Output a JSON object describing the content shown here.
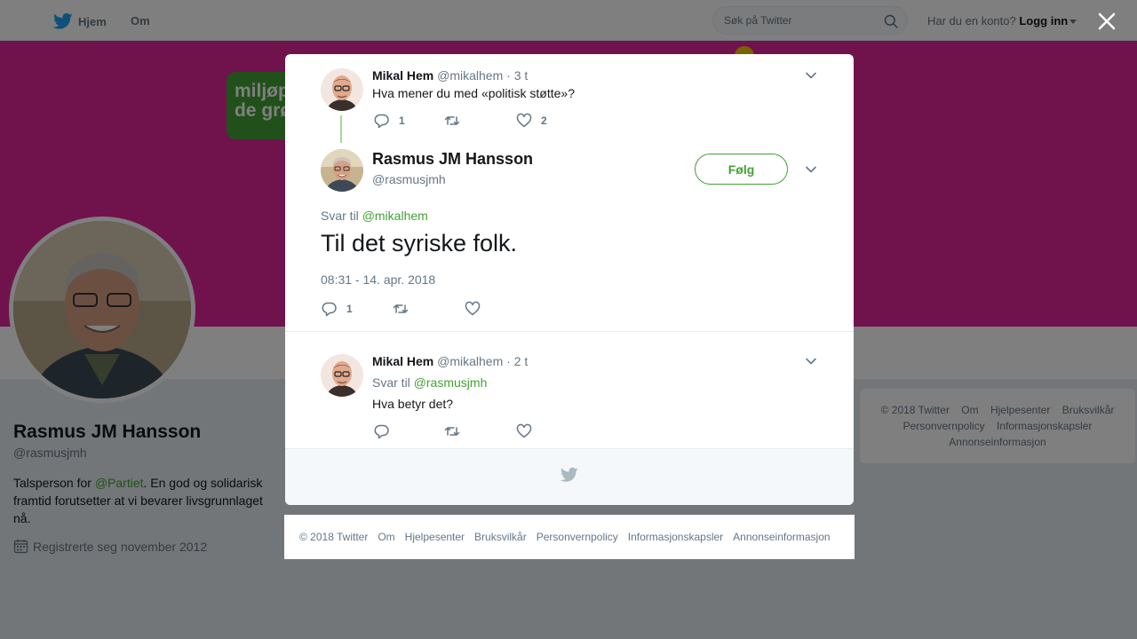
{
  "topbar": {
    "home_label": "Hjem",
    "about_label": "Om",
    "search_placeholder": "Søk på Twitter",
    "account_prompt": "Har du en konto?",
    "login_label": "Logg inn"
  },
  "banner": {
    "logo_line1": "miljøp",
    "logo_line2": "de grø"
  },
  "profile": {
    "name": "Rasmus JM Hansson",
    "handle": "@rasmusjmh",
    "bio_prefix": "Talsperson for ",
    "bio_mention": "@Partiet",
    "bio_suffix": ". En god og solidarisk framtid forutsetter at vi bevarer livsgrunnlaget nå.",
    "joined": "Registrerte seg november 2012"
  },
  "side_footer": {
    "links": [
      "© 2018 Twitter",
      "Om",
      "Hjelpesenter",
      "Bruksvilkår",
      "Personvernpolicy",
      "Informasjonskapsler",
      "Annonseinformasjon"
    ]
  },
  "modal": {
    "parent_tweet": {
      "name": "Mikal Hem",
      "handle": "@mikalhem",
      "separator": "·",
      "time": "3 t",
      "text": "Hva mener du med «politisk støtte»?",
      "reply_count": "1",
      "like_count": "2"
    },
    "main_tweet": {
      "name": "Rasmus JM Hansson",
      "handle": "@rasmusjmh",
      "follow_label": "Følg",
      "reply_prefix": "Svar til",
      "reply_to": "@mikalhem",
      "text": "Til det syriske folk.",
      "timestamp": "08:31 - 14. apr. 2018",
      "reply_count": "1"
    },
    "reply_tweet": {
      "name": "Mikal Hem",
      "handle": "@mikalhem",
      "separator": "·",
      "time": "2 t",
      "reply_prefix": "Svar til",
      "reply_to": "@rasmusjmh",
      "text": "Hva betyr det?"
    }
  },
  "bottom_footer": {
    "links": [
      "© 2018 Twitter",
      "Om",
      "Hjelpesenter",
      "Bruksvilkår",
      "Personvernpolicy",
      "Informasjonskapsler",
      "Annonseinformasjon"
    ]
  },
  "colors": {
    "accent": "#43a135",
    "banner": "#e0279a",
    "twitter_blue": "#1da1f2",
    "muted": "#657786"
  },
  "icons": [
    "twitter-bird-icon",
    "search-icon",
    "chevron-down-icon",
    "close-icon",
    "reply-icon",
    "retweet-icon",
    "heart-icon",
    "calendar-icon"
  ]
}
